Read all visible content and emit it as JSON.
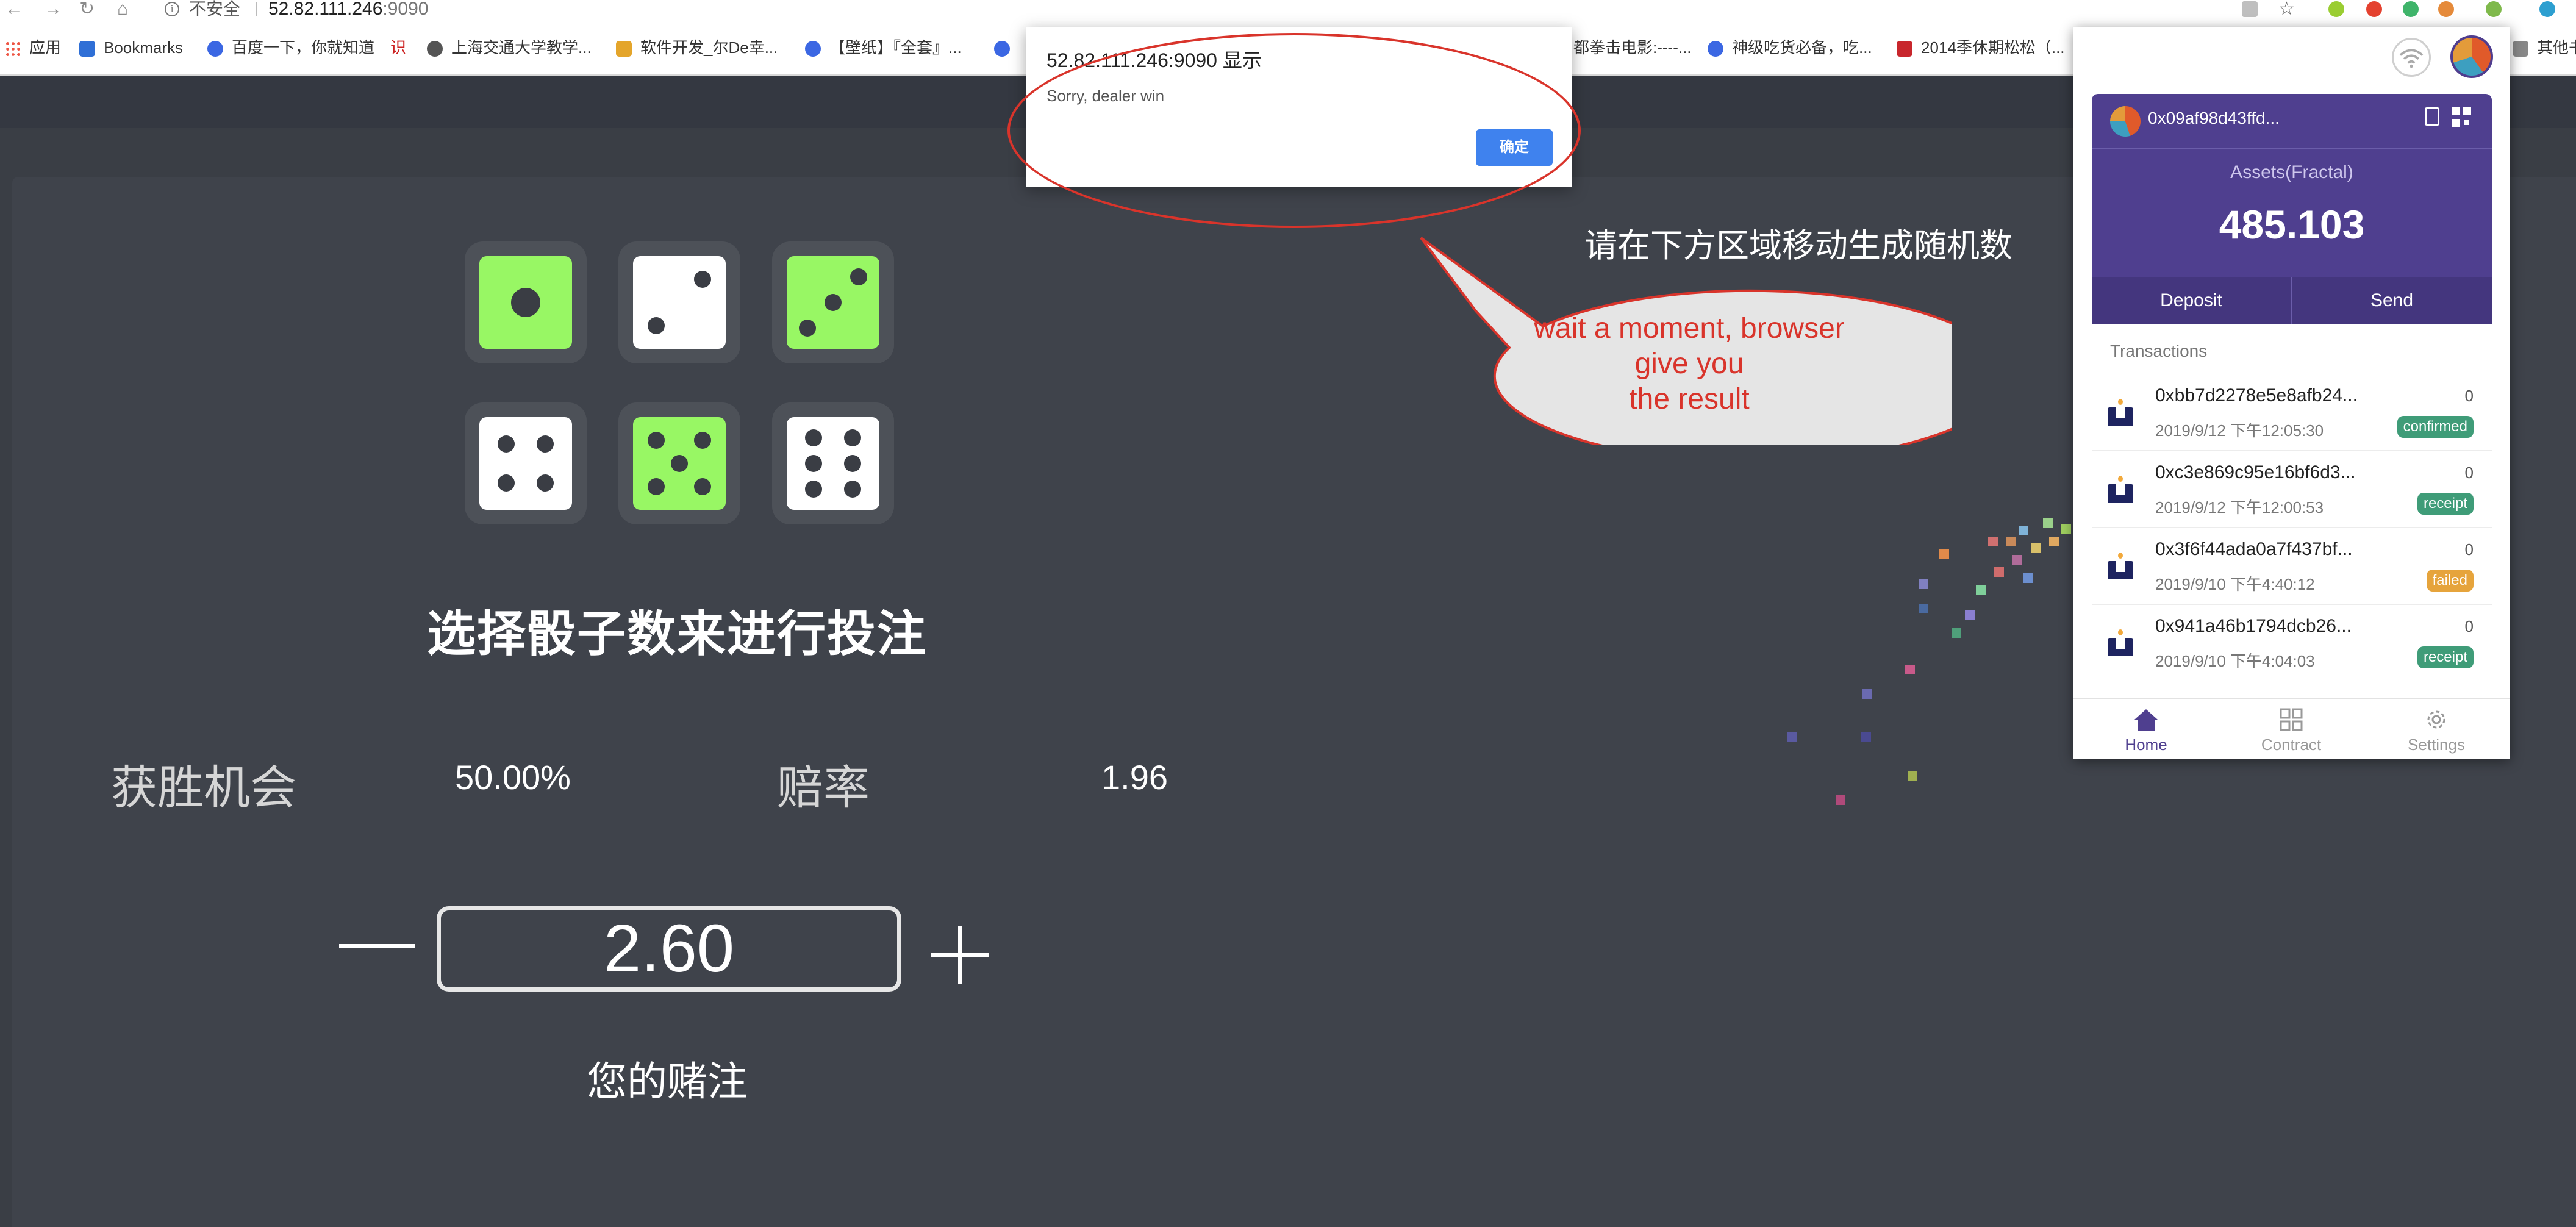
{
  "browser": {
    "nav": {
      "back": "←",
      "forward": "→",
      "reload": "↻",
      "home": "⌂",
      "info": "i"
    },
    "security_text": "不安全",
    "host": "52.82.111.246",
    "port": ":9090",
    "bookmarks": [
      {
        "label": "应用",
        "icon": "apps-grid-icon"
      },
      {
        "label": "Bookmarks",
        "icon": "star-icon"
      },
      {
        "label": "百度一下，你就知道",
        "icon": "paw-icon"
      },
      {
        "label": "识",
        "icon": "text-icon"
      },
      {
        "label": "上海交通大学教学...",
        "icon": "globe-icon"
      },
      {
        "label": "软件开发_尔De幸...",
        "icon": "bookmark-icon"
      },
      {
        "label": "【壁纸】『全套』...",
        "icon": "paw-icon"
      },
      {
        "label": "",
        "icon": "paw-icon"
      },
      {
        "label": "都拳击电影:----...",
        "icon": "bookmark-icon"
      },
      {
        "label": "神级吃货必备，吃...",
        "icon": "paw-icon"
      },
      {
        "label": "2014季休期松松（...",
        "icon": "tiger-icon"
      },
      {
        "label": "其他书",
        "icon": "folder-icon"
      }
    ]
  },
  "alert": {
    "title": "52.82.111.246:9090 显示",
    "message": "Sorry, dealer win",
    "ok_label": "确定"
  },
  "annotation": {
    "bubble_lines": [
      "wait a moment, browser",
      "give you",
      "the result"
    ],
    "color": "#d9342b"
  },
  "game": {
    "random_hint": "请在下方区域移动生成随机数",
    "heading": "选择骰子数来进行投注",
    "dice": [
      {
        "value": 1,
        "selected": true
      },
      {
        "value": 2,
        "selected": false
      },
      {
        "value": 3,
        "selected": true
      },
      {
        "value": 4,
        "selected": false
      },
      {
        "value": 5,
        "selected": true
      },
      {
        "value": 6,
        "selected": false
      }
    ],
    "win_chance_label": "获胜机会",
    "win_chance_value": "50.00%",
    "odds_label": "赔率",
    "odds_value": "1.96",
    "stake_value": "2.60",
    "stake_label": "您的赌注",
    "accent_color": "#98f764"
  },
  "wallet": {
    "account_address": "0x09af98d43ffd...",
    "assets_label": "Assets(Fractal)",
    "assets_value": "485.103",
    "deposit_label": "Deposit",
    "send_label": "Send",
    "transactions_title": "Transactions",
    "transactions": [
      {
        "hash": "0xbb7d2278e5e8afb24...",
        "amount": "0",
        "time": "2019/9/12 下午12:05:30",
        "status": "confirmed",
        "status_color": "#3f9c78"
      },
      {
        "hash": "0xc3e869c95e16bf6d3...",
        "amount": "0",
        "time": "2019/9/12 下午12:00:53",
        "status": "receipt",
        "status_color": "#3f9c78"
      },
      {
        "hash": "0x3f6f44ada0a7f437bf...",
        "amount": "0",
        "time": "2019/9/10 下午4:40:12",
        "status": "failed",
        "status_color": "#e6a43c"
      },
      {
        "hash": "0x941a46b1794dcb26...",
        "amount": "0",
        "time": "2019/9/10 下午4:04:03",
        "status": "receipt",
        "status_color": "#3f9c78"
      }
    ],
    "tabs": [
      {
        "label": "Home",
        "icon": "home-icon",
        "active": true
      },
      {
        "label": "Contract",
        "icon": "grid-icon",
        "active": false
      },
      {
        "label": "Settings",
        "icon": "gear-icon",
        "active": false
      }
    ],
    "theme_color": "#4f3f8f"
  }
}
